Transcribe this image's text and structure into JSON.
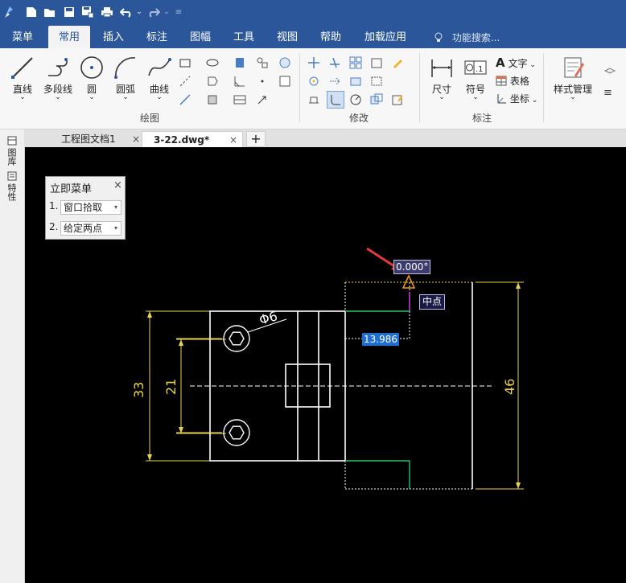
{
  "title_bar": {
    "quick_access": [
      "app-logo-icon",
      "new-file-icon",
      "open-file-icon",
      "save-icon",
      "save-as-icon",
      "print-icon",
      "undo-icon",
      "redo-icon",
      "customize-icon"
    ]
  },
  "menu": {
    "items": [
      "菜单",
      "常用",
      "插入",
      "标注",
      "图幅",
      "工具",
      "视图",
      "帮助",
      "加载应用"
    ],
    "active": "常用",
    "search_placeholder": "功能搜索..."
  },
  "ribbon": {
    "draw": {
      "tools": [
        "直线",
        "多段线",
        "圆",
        "圆弧",
        "曲线"
      ],
      "group_label": "绘图"
    },
    "modify": {
      "group_label": "修改"
    },
    "annotate": {
      "tools": [
        "尺寸",
        "符号"
      ],
      "side_tools": [
        "文字",
        "表格",
        "坐标"
      ],
      "group_label": "标注"
    },
    "style": {
      "label": "样式管理"
    }
  },
  "doc_tabs": [
    {
      "label": "工程图文档1",
      "active": false
    },
    {
      "label": "3-22.dwg*",
      "active": true
    }
  ],
  "left_panel": {
    "tabs": [
      "图库",
      "特性"
    ]
  },
  "immediate_menu": {
    "title": "立即菜单",
    "rows": [
      {
        "index": "1.",
        "value": "窗口拾取"
      },
      {
        "index": "2.",
        "value": "给定两点"
      }
    ]
  },
  "drawing": {
    "dims": {
      "height_33": "33",
      "height_21": "21",
      "height_46": "46",
      "diameter": "Φ6"
    },
    "angle_readout": "0.000°",
    "length_readout": "13.986",
    "snap_tooltip": "中点"
  },
  "colors": {
    "title_bar": "#2b579a",
    "canvas": "#000000",
    "dimension": "#e8d44d",
    "outline": "#ffffff",
    "green_line": "#22c55e",
    "magenta_line": "#d946ef",
    "annotation_arrow": "#e53935"
  }
}
